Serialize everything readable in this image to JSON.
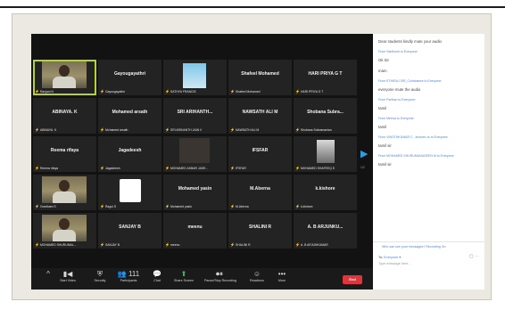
{
  "participants": [
    {
      "name": "",
      "label": "Ranjani N",
      "tile": "person",
      "active": true
    },
    {
      "name": "Gayougayathri",
      "label": "Gayougayathri",
      "tile": "text"
    },
    {
      "name": "",
      "label": "SATHYA FRANCIS",
      "tile": "avatar"
    },
    {
      "name": "Shafeel Mohamed",
      "label": "Shafeel Mohamed",
      "tile": "text"
    },
    {
      "name": "HARI PRIYA G T",
      "label": "HARI PRIYA G T",
      "tile": "text"
    },
    {
      "name": "ABINAYA. K",
      "label": "ABINAYA. K",
      "tile": "text"
    },
    {
      "name": "Mohamed arsath",
      "label": "Mohamed arsath",
      "tile": "text"
    },
    {
      "name": "SRI ARIHANTH...",
      "label": "SRI ARIHANTH JAIN V",
      "tile": "text"
    },
    {
      "name": "NAWSATH ALI M",
      "label": "NAWSATH ALI M",
      "tile": "text"
    },
    {
      "name": "Shobana Subra...",
      "label": "Shobana Subramanian",
      "tile": "text"
    },
    {
      "name": "Reema rifaya",
      "label": "Reema rifaya",
      "tile": "text"
    },
    {
      "name": "Jagadeesh",
      "label": "Jagadeesh",
      "tile": "text"
    },
    {
      "name": "",
      "label": "MOHAMED AKBAR JASE...",
      "tile": "dark"
    },
    {
      "name": "IFSFAR",
      "label": "IFSFAR",
      "tile": "text"
    },
    {
      "name": "",
      "label": "MOHAMED SHAFEEQ S",
      "tile": "photo"
    },
    {
      "name": "",
      "label": "Gowtham S",
      "tile": "person"
    },
    {
      "name": "",
      "label": "Ragul S",
      "tile": "logo"
    },
    {
      "name": "Mohamed yasin",
      "label": "Mohamed yasin",
      "tile": "text"
    },
    {
      "name": "M.Aberna",
      "label": "M.Aberna",
      "tile": "text"
    },
    {
      "name": "k.kishore",
      "label": "k.kishore",
      "tile": "text"
    },
    {
      "name": "",
      "label": "MOHAMED SHURUMAL...",
      "tile": "person"
    },
    {
      "name": "SANJAY B",
      "label": "SANJAY B",
      "tile": "text"
    },
    {
      "name": "meenu",
      "label": "meenu",
      "tile": "text"
    },
    {
      "name": "SHALINI R",
      "label": "SHALINI R",
      "tile": "text"
    },
    {
      "name": "A. B ARJUNKU...",
      "label": "A. B ARJUNKUMAR",
      "tile": "text"
    }
  ],
  "pager": {
    "arrow": "▶",
    "text": "1/2"
  },
  "toolbar": [
    {
      "icon": "^",
      "label": ""
    },
    {
      "icon": "▮◀",
      "label": "Start Video"
    },
    {
      "icon": "⛨",
      "label": "Security"
    },
    {
      "icon": "👥 111",
      "label": "Participants"
    },
    {
      "icon": "💬",
      "label": "Chat"
    },
    {
      "icon": "⬆",
      "label": "Share Screen"
    },
    {
      "icon": "⏺⏸",
      "label": "Pause/Stop Recording"
    },
    {
      "icon": "☺",
      "label": "Reactions"
    },
    {
      "icon": "•••",
      "label": "More"
    }
  ],
  "end_label": "End",
  "chat": {
    "messages": [
      {
        "from": "",
        "text": "Dear students kindly mute your audio"
      },
      {
        "from": "From Santhosh to Everyone:",
        "text": ""
      },
      {
        "from": "",
        "text": "Ok Sir"
      },
      {
        "from": "",
        "text": "mam"
      },
      {
        "from": "From ETHIRAJ SIR_Coimbatore to Everyone:",
        "text": ""
      },
      {
        "from": "",
        "text": "everyone mute the audio"
      },
      {
        "from": "From Parthan to Everyone:",
        "text": ""
      },
      {
        "from": "",
        "text": "tamil"
      },
      {
        "from": "From Meena to Everyone:",
        "text": ""
      },
      {
        "from": "",
        "text": "tamil"
      },
      {
        "from": "From VINOTHKUMAR C - lecturer cs to Everyone:",
        "text": ""
      },
      {
        "from": "",
        "text": "tamil sir"
      },
      {
        "from": "From MOHAMED SHURUMANUDEEN M to Everyone:",
        "text": ""
      },
      {
        "from": "",
        "text": "tamil sir"
      }
    ],
    "who_can_see": "Who can see your messages? Recording On",
    "to_label": "To:",
    "to_value": "Everyone ▾",
    "placeholder": "Type message here..."
  }
}
